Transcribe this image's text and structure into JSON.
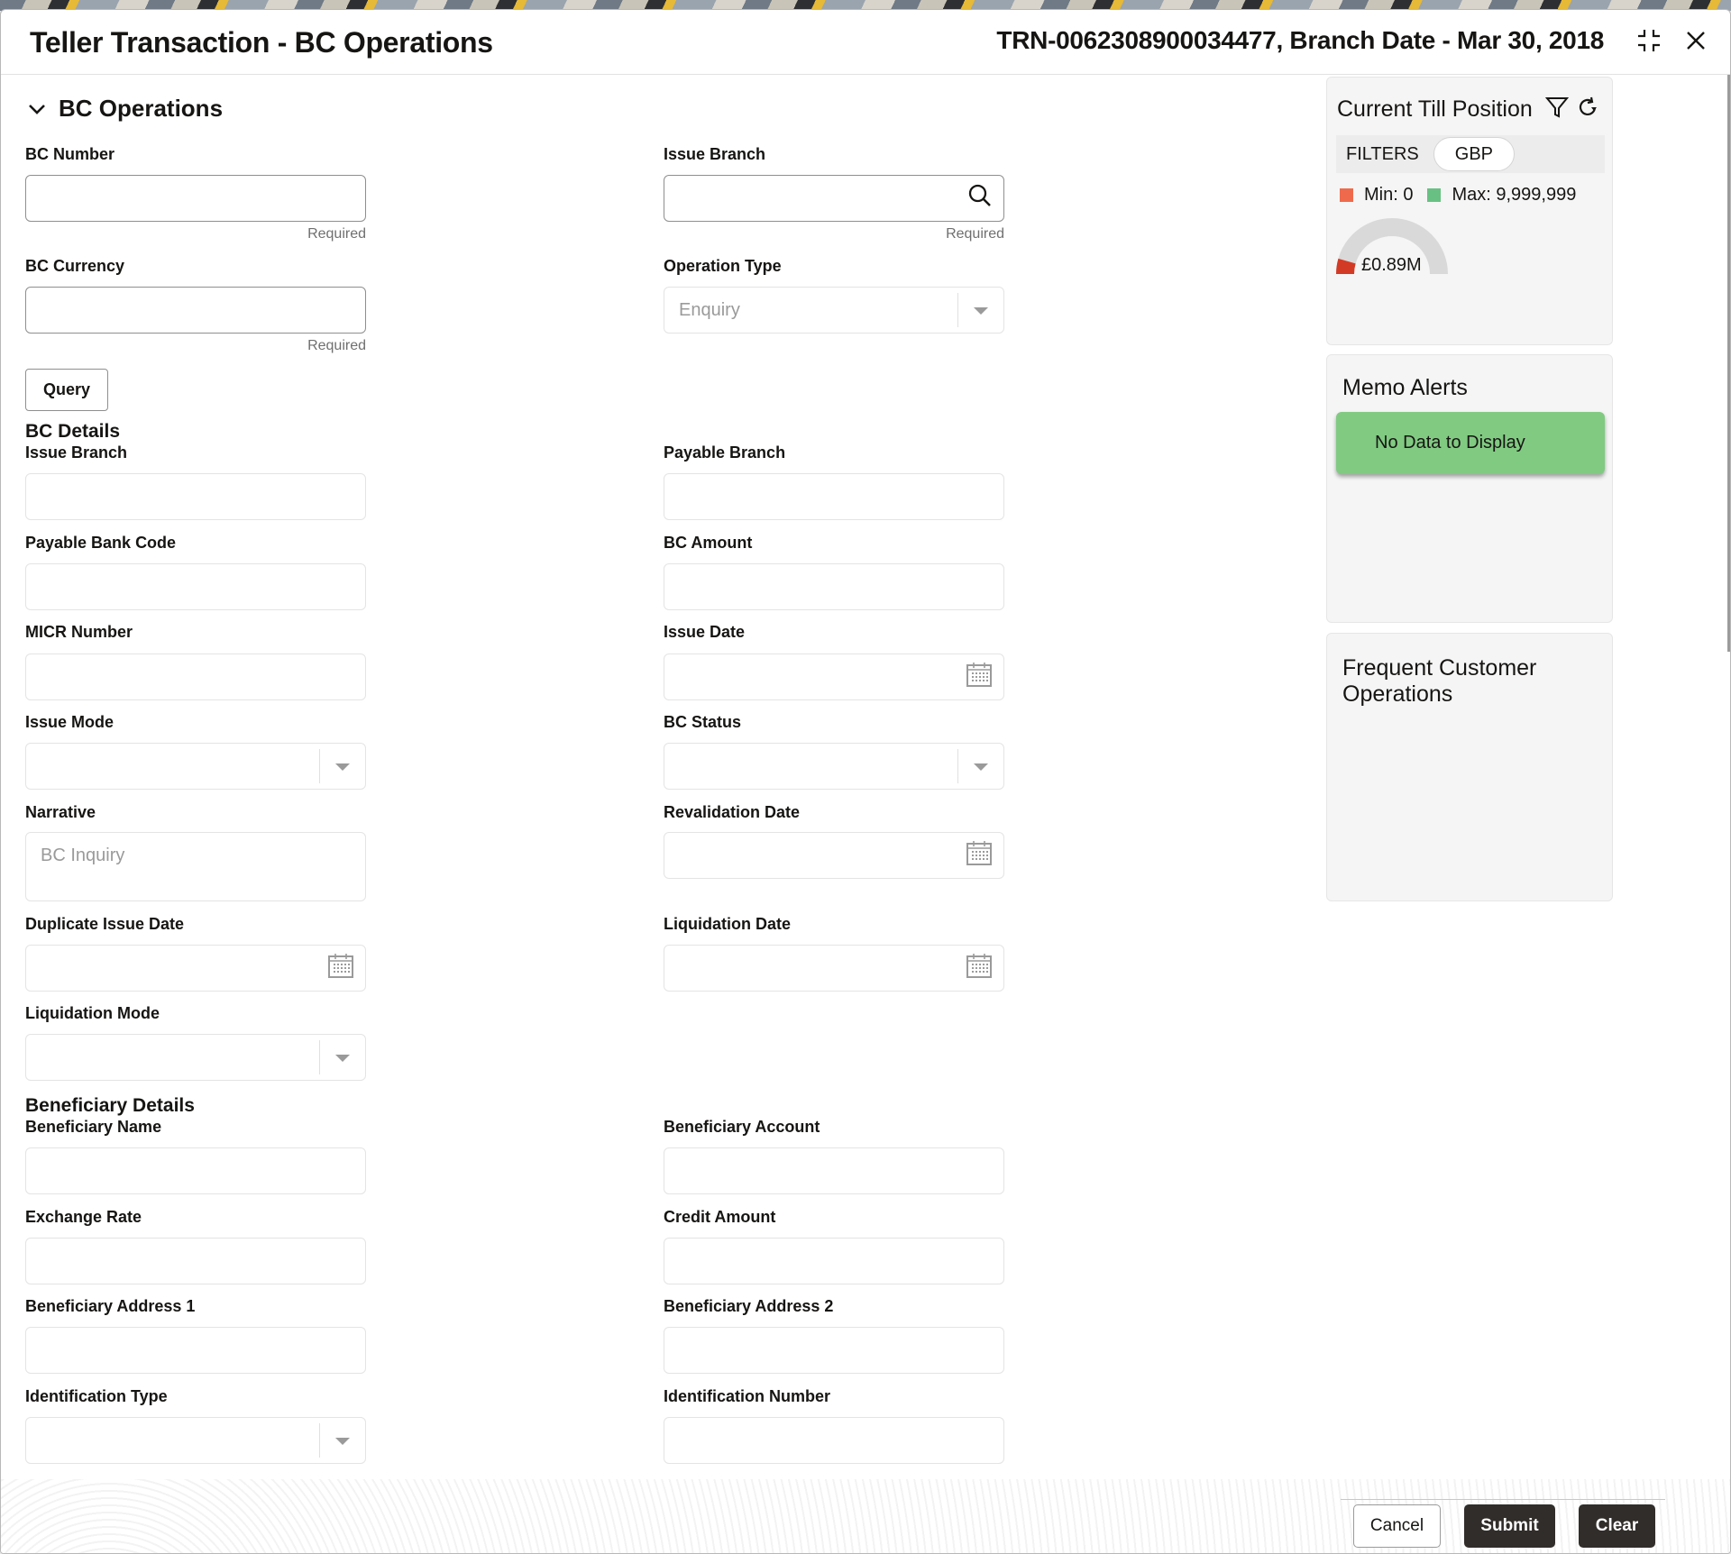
{
  "window": {
    "title": "Teller Transaction - BC Operations",
    "meta": "TRN-0062308900034477, Branch Date - Mar 30, 2018",
    "icons": {
      "compress": "compress-icon",
      "close": "close-icon"
    }
  },
  "section": {
    "title": "BC Operations",
    "expanded": true
  },
  "query_form": {
    "bc_number": {
      "label": "BC Number",
      "value": "",
      "hint": "Required"
    },
    "issue_branch": {
      "label": "Issue Branch",
      "value": "",
      "hint": "Required",
      "icon": "search-icon"
    },
    "bc_currency": {
      "label": "BC Currency",
      "value": "",
      "hint": "Required"
    },
    "operation_type": {
      "label": "Operation Type",
      "value": "Enquiry"
    },
    "query_button": "Query"
  },
  "bc_details": {
    "heading": "BC Details",
    "issue_branch": {
      "label": "Issue Branch",
      "value": ""
    },
    "payable_branch": {
      "label": "Payable Branch",
      "value": ""
    },
    "payable_bank_code": {
      "label": "Payable Bank Code",
      "value": ""
    },
    "bc_amount": {
      "label": "BC Amount",
      "value": ""
    },
    "micr_number": {
      "label": "MICR Number",
      "value": ""
    },
    "issue_date": {
      "label": "Issue Date",
      "value": ""
    },
    "issue_mode": {
      "label": "Issue Mode",
      "value": ""
    },
    "bc_status": {
      "label": "BC Status",
      "value": ""
    },
    "narrative": {
      "label": "Narrative",
      "value": "BC Inquiry"
    },
    "revalidation_date": {
      "label": "Revalidation Date",
      "value": ""
    },
    "duplicate_issue_date": {
      "label": "Duplicate Issue Date",
      "value": ""
    },
    "liquidation_date": {
      "label": "Liquidation Date",
      "value": ""
    },
    "liquidation_mode": {
      "label": "Liquidation Mode",
      "value": ""
    }
  },
  "beneficiary_details": {
    "heading": "Beneficiary Details",
    "beneficiary_name": {
      "label": "Beneficiary Name",
      "value": ""
    },
    "beneficiary_account": {
      "label": "Beneficiary Account",
      "value": ""
    },
    "exchange_rate": {
      "label": "Exchange Rate",
      "value": ""
    },
    "credit_amount": {
      "label": "Credit Amount",
      "value": ""
    },
    "beneficiary_address_1": {
      "label": "Beneficiary Address 1",
      "value": ""
    },
    "beneficiary_address_2": {
      "label": "Beneficiary Address 2",
      "value": ""
    },
    "identification_type": {
      "label": "Identification Type",
      "value": ""
    },
    "identification_number": {
      "label": "Identification Number",
      "value": ""
    }
  },
  "sidebar": {
    "till": {
      "title": "Current Till Position",
      "filters_label": "FILTERS",
      "currency_chip": "GBP",
      "min_label": "Min: 0",
      "max_label": "Max: 9,999,999",
      "value_label": "£0.89M",
      "gauge": {
        "min": 0,
        "max": 9999999,
        "value": 890000
      },
      "colors": {
        "min": "#ef6a4c",
        "max": "#68c183",
        "fill": "#d33a25",
        "track": "#d9d9d9"
      }
    },
    "memo_alerts": {
      "title": "Memo Alerts",
      "empty_message": "No Data to Display",
      "banner_color": "#81ca82"
    },
    "frequent_ops": {
      "title": "Frequent Customer Operations"
    }
  },
  "footer": {
    "cancel": "Cancel",
    "submit": "Submit",
    "clear": "Clear"
  }
}
